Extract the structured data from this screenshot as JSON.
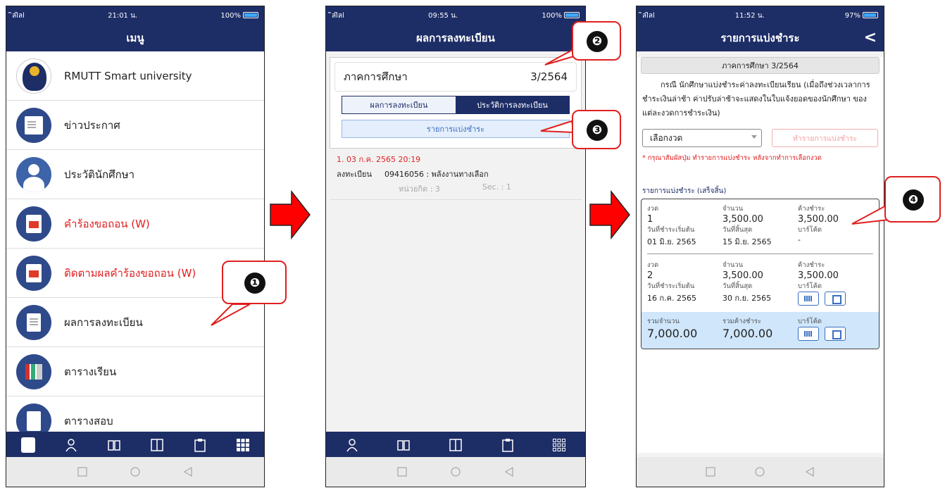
{
  "phone1": {
    "status": {
      "carrier": "ิลlิลl",
      "time": "21:01 น.",
      "battery": "100%"
    },
    "title": "เมนู",
    "items": [
      {
        "label": "RMUTT Smart university"
      },
      {
        "label": "ข่าวประกาศ"
      },
      {
        "label": "ประวัตินักศึกษา"
      },
      {
        "label": "คำร้องขอถอน (W)"
      },
      {
        "label": "ติดตามผลคำร้องขอถอน (W)"
      },
      {
        "label": "ผลการลงทะเบียน"
      },
      {
        "label": "ตารางเรียน"
      },
      {
        "label": "ตารางสอบ"
      }
    ]
  },
  "phone2": {
    "status": {
      "carrier": "ิลlิลl",
      "time": "09:55 น.",
      "battery": "100%"
    },
    "title": "ผลการลงทะเบียน",
    "semester_label": "ภาคการศึกษา",
    "semester_value": "3/2564",
    "tab1": "ผลการลงทะเบียน",
    "tab2": "ประวัติการลงทะเบียน",
    "installment_button": "รายการแบ่งชำระ",
    "record_title": "1. 03 ก.ค. 2565 20:19",
    "record_type": "ลงทะเบียน",
    "record_course": "09416056 : พลังงานทางเลือก",
    "record_credits": "หน่วยกิต : 3",
    "record_sec": "Sec. : 1"
  },
  "phone3": {
    "status": {
      "carrier": "ิลlิลl",
      "time": "11:52 น.",
      "battery": "97%"
    },
    "title": "รายการแบ่งชำระ",
    "back": "<",
    "semester_bar": "ภาคการศึกษา 3/2564",
    "notice": "กรณี นักศึกษาแบ่งชำระค่าลงทะเบียนเรียน (เมื่อถึงช่วงเวลาการชำระเงินล่าช้า ค่าปรับล่าช้าจะแสดงในใบแจ้งยอดของนักศึกษา ของแต่ละงวดการชำระเงิน)",
    "select_value": "เลือกงวด",
    "make_button": "ทำรายการแบ่งชำระ",
    "hint": "* กรุณาสัมผัสปุ่ม ทำรายการแบ่งชำระ หลังจากทำการเลือกงวด",
    "list_title": "รายการแบ่งชำระ (เสร็จสิ้น)",
    "labels": {
      "period": "งวด",
      "amount": "จำนวน",
      "outstanding": "ค้างชำระ",
      "start": "วันที่ชำระเริ่มต้น",
      "end": "วันที่สิ้นสุด",
      "barcode": "บาร์โค้ด",
      "total_amount": "รวมจำนวน",
      "total_outstanding": "รวมค้างชำระ"
    },
    "installments": [
      {
        "period": "1",
        "amount": "3,500.00",
        "outstanding": "3,500.00",
        "start": "01 มิ.ย. 2565",
        "end": "15 มิ.ย. 2565",
        "barcode": "-"
      },
      {
        "period": "2",
        "amount": "3,500.00",
        "outstanding": "3,500.00",
        "start": "16 ก.ค. 2565",
        "end": "30 ก.ย. 2565"
      }
    ],
    "total_amount": "7,000.00",
    "total_outstanding": "7,000.00"
  },
  "callouts": [
    "❶",
    "❷",
    "❸",
    "❹"
  ],
  "colors": {
    "navy": "#1d2d66",
    "red": "#e02020",
    "accent": "#3b6fc1",
    "total_bg": "#cfe6fb"
  }
}
